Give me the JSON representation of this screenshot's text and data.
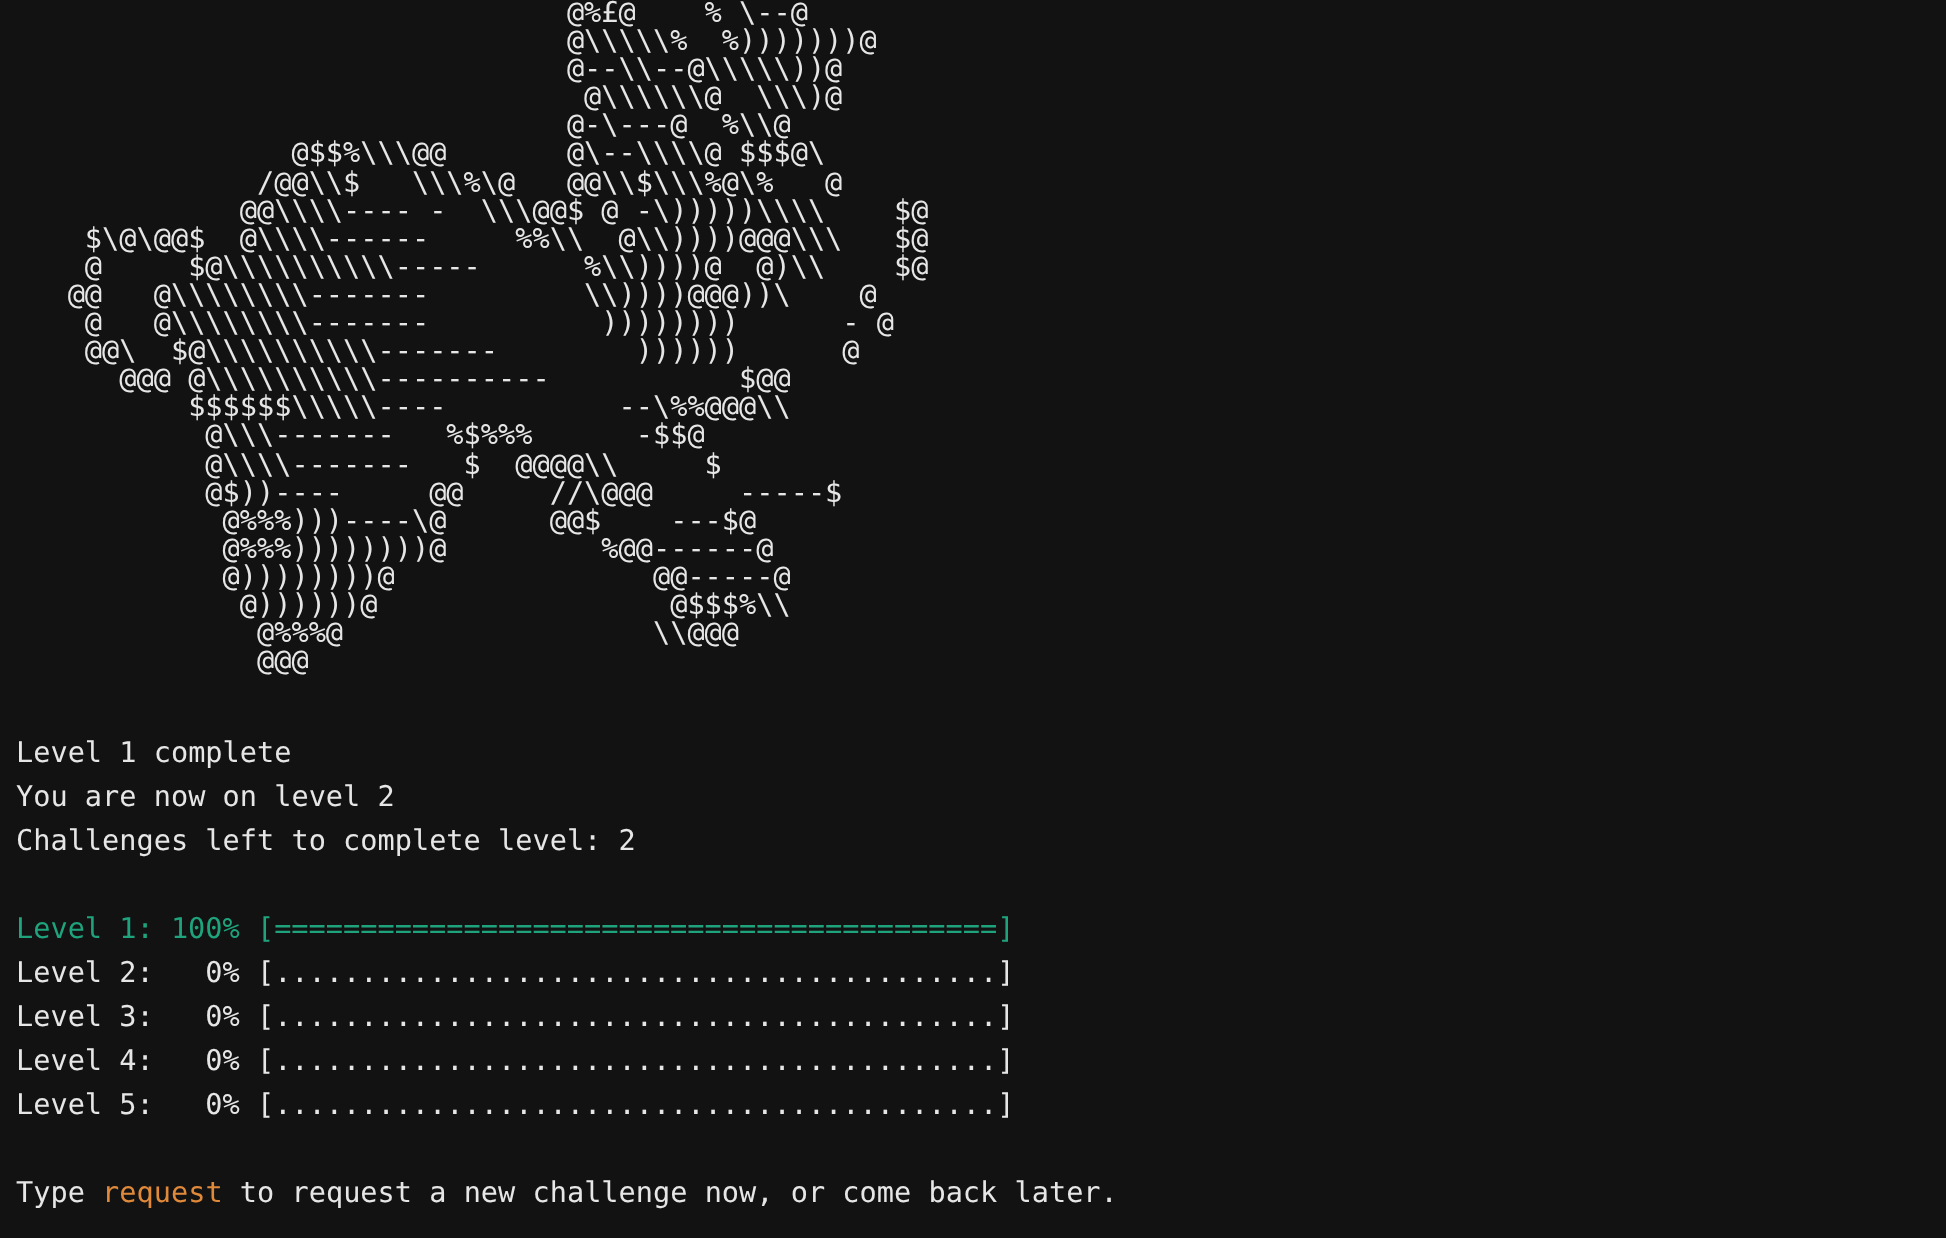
{
  "ascii_art": {
    "lines": [
      "                                @%£@    % \\--@",
      "                                @\\\\\\\\\\%  %)))))))@",
      "                                @--\\\\--@\\\\\\\\\\))@",
      "                                 @\\\\\\\\\\\\@  \\\\\\)@",
      "                                @-\\---@  %\\\\@",
      "                @$$%\\\\\\@@       @\\--\\\\\\\\@ $$$@\\",
      "              /@@\\\\$   \\\\\\%\\@   @@\\\\$\\\\\\%@\\%   @",
      "             @@\\\\\\\\---- -  \\\\\\@@$ @ -\\)))))\\\\\\\\    $@",
      "    $\\@\\@@$  @\\\\\\\\------     %%\\\\  @\\\\))))@@@\\\\\\   $@",
      "    @     $@\\\\\\\\\\\\\\\\\\\\-----      %\\\\))))@  @)\\\\    $@",
      "   @@   @\\\\\\\\\\\\\\\\-------         \\\\))))@@@))\\    @",
      "    @   @\\\\\\\\\\\\\\\\-------          ))))))))      - @",
      "    @@\\  $@\\\\\\\\\\\\\\\\\\\\-------        ))))))      @",
      "      @@@ @\\\\\\\\\\\\\\\\\\\\----------           $@@",
      "          $$$$$$\\\\\\\\\\----          --\\%%@@@\\\\",
      "           @\\\\\\-------   %$%%%      -$$@",
      "           @\\\\\\\\-------   $  @@@@\\\\     $",
      "           @$))----     @@     //\\@@@     -----$",
      "            @%%%)))----\\@      @@$    ---$@",
      "            @%%%))))))))@         %@@------@",
      "            @))))))))@               @@-----@",
      "             @))))))@                 @$$$%\\\\",
      "              @%%%@                  \\\\@@@",
      "              @@@"
    ]
  },
  "messages": [
    "Level 1 complete",
    "You are now on level 2",
    "Challenges left to complete level: 2"
  ],
  "levels": [
    {
      "label": "Level 1:",
      "percent": "100%",
      "bar": "[==========================================]",
      "complete": true
    },
    {
      "label": "Level 2:",
      "percent": "0%",
      "bar": "[..........................................]",
      "complete": false
    },
    {
      "label": "Level 3:",
      "percent": "0%",
      "bar": "[..........................................]",
      "complete": false
    },
    {
      "label": "Level 4:",
      "percent": "0%",
      "bar": "[..........................................]",
      "complete": false
    },
    {
      "label": "Level 5:",
      "percent": "0%",
      "bar": "[..........................................]",
      "complete": false
    }
  ],
  "prompt": {
    "before": "Type",
    "command": "request",
    "after": "to request a new challenge now, or come back later."
  }
}
